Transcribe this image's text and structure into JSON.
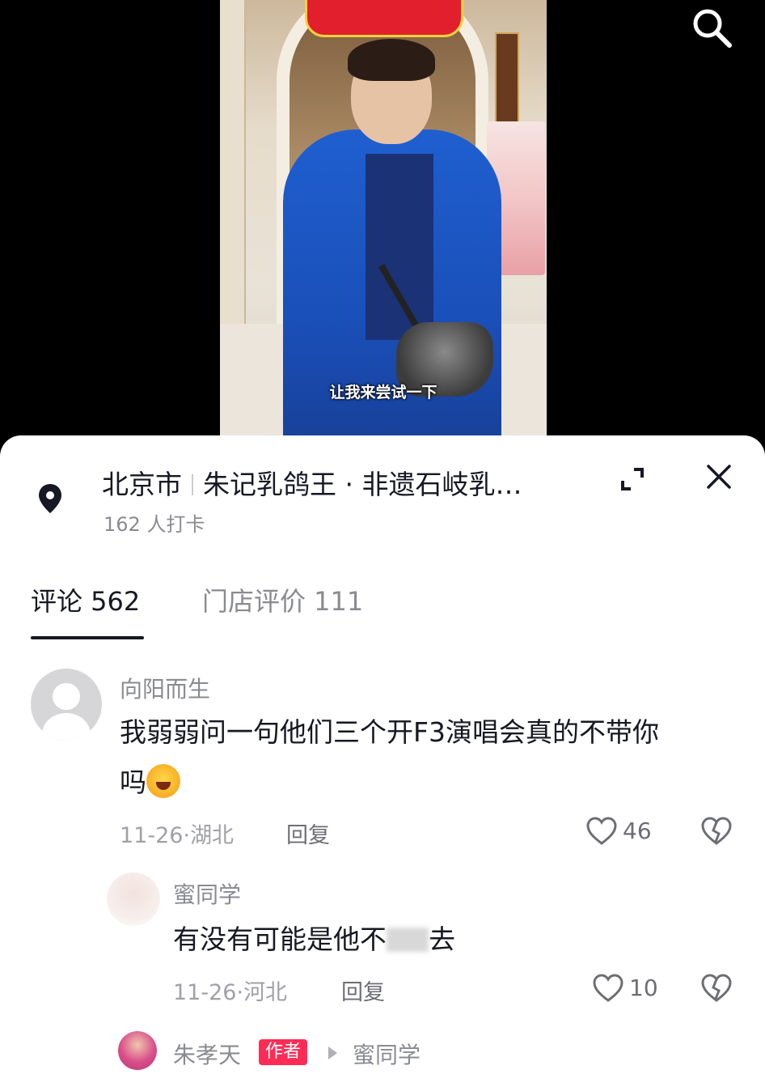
{
  "video": {
    "subtitle": "让我来尝试一下",
    "search_icon": "search-icon"
  },
  "location": {
    "city": "北京市",
    "store": "朱记乳鸽王 · 非遗石岐乳…",
    "checkin": "162 人打卡",
    "pin_icon": "location-pin-icon",
    "expand_icon": "expand-icon",
    "close_icon": "close-icon"
  },
  "tabs": {
    "comments": "评论 562",
    "reviews": "门店评价 111"
  },
  "comments": [
    {
      "user": "向阳而生",
      "text_line1": "我弱弱问一句他们三个开F3演唱会真的不带你",
      "text_line2": "吗",
      "date": "11-26",
      "region": "湖北",
      "reply_label": "回复",
      "likes": "46"
    },
    {
      "user": "蜜同学",
      "text_pre": "有没有可能是他不",
      "text_post": "去",
      "date": "11-26",
      "region": "河北",
      "reply_label": "回复",
      "likes": "10"
    },
    {
      "user": "朱孝天",
      "badge": "作者",
      "reply_to": "蜜同学"
    }
  ],
  "colors": {
    "accent": "#fe2c55",
    "text_primary": "#161823",
    "text_secondary": "#8a8b91"
  }
}
